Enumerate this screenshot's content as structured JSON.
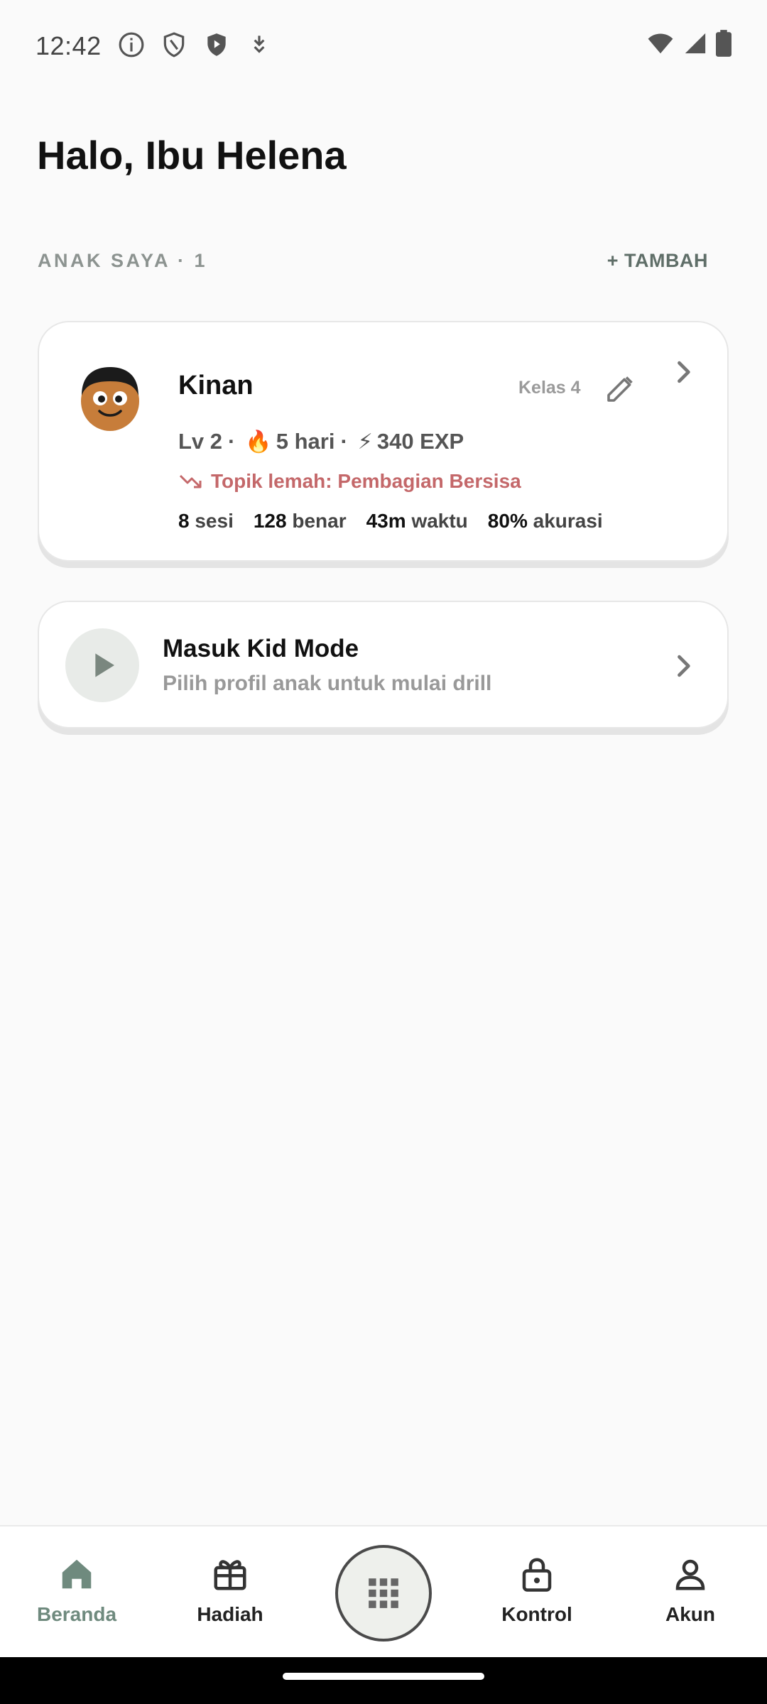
{
  "status_bar": {
    "time": "12:42",
    "left_icons": [
      "info-icon",
      "shield-outline-icon",
      "shield-play-icon",
      "download-arrow-icon"
    ],
    "right_icons": [
      "wifi-icon",
      "signal-icon",
      "battery-icon"
    ]
  },
  "greeting": "Halo, Ibu Helena",
  "section": {
    "label": "ANAK SAYA · 1",
    "add_label": "+ TAMBAH"
  },
  "child": {
    "name": "Kinan",
    "grade": "Kelas 4",
    "level": "Lv 2",
    "sep1": "·",
    "fire_emoji": "🔥",
    "streak": "5 hari",
    "sep2": "·",
    "bolt_emoji": "⚡",
    "exp": "340 EXP",
    "weak_topic": "Topik lemah: Pembagian Bersisa",
    "metrics": [
      {
        "value": "8",
        "unit": "sesi"
      },
      {
        "value": "128",
        "unit": "benar"
      },
      {
        "value": "43m",
        "unit": "waktu"
      },
      {
        "value": "80%",
        "unit": "akurasi"
      }
    ]
  },
  "kid_mode": {
    "title": "Masuk Kid Mode",
    "subtitle": "Pilih profil anak untuk mulai drill"
  },
  "nav": {
    "items": [
      {
        "label": "Beranda",
        "icon": "home-icon",
        "active": true
      },
      {
        "label": "Hadiah",
        "icon": "gift-icon",
        "active": false
      },
      {
        "label": "Kontrol",
        "icon": "lock-icon",
        "active": false
      },
      {
        "label": "Akun",
        "icon": "person-icon",
        "active": false
      }
    ],
    "center_icon": "grid-icon"
  },
  "colors": {
    "accent": "#6f8a7e",
    "weak_topic": "#c4686a",
    "background": "#fafafa"
  }
}
